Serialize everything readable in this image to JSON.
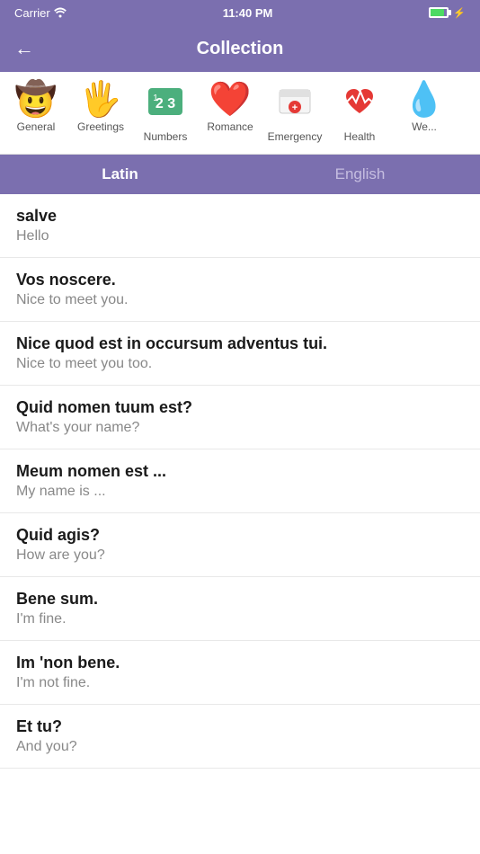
{
  "status": {
    "carrier": "Carrier",
    "time": "11:40 PM"
  },
  "header": {
    "title": "Collection",
    "back_label": "←"
  },
  "categories": [
    {
      "id": "general",
      "emoji": "🤠",
      "label": "General"
    },
    {
      "id": "greetings",
      "emoji": "🖐",
      "label": "Greetings"
    },
    {
      "id": "numbers",
      "emoji": "🔢",
      "label": "Numbers"
    },
    {
      "id": "romance",
      "emoji": "❤️",
      "label": "Romance"
    },
    {
      "id": "emergency",
      "emoji": "🚑",
      "label": "Emergency"
    },
    {
      "id": "health",
      "emoji": "❤️‍🩺",
      "label": "Health"
    },
    {
      "id": "weather",
      "emoji": "💧",
      "label": "We..."
    }
  ],
  "lang_tabs": [
    {
      "id": "latin",
      "label": "Latin",
      "active": true
    },
    {
      "id": "english",
      "label": "English",
      "active": false
    }
  ],
  "phrases": [
    {
      "latin": "salve",
      "english": "Hello"
    },
    {
      "latin": "Vos noscere.",
      "english": "Nice to meet you."
    },
    {
      "latin": "Nice quod est in occursum adventus tui.",
      "english": "Nice to meet you too."
    },
    {
      "latin": "Quid nomen tuum est?",
      "english": "What's your name?"
    },
    {
      "latin": "Meum nomen est ...",
      "english": "My name is ..."
    },
    {
      "latin": "Quid agis?",
      "english": "How are you?"
    },
    {
      "latin": "Bene sum.",
      "english": "I'm fine."
    },
    {
      "latin": "Im 'non bene.",
      "english": "I'm not fine."
    },
    {
      "latin": "Et tu?",
      "english": "And you?"
    }
  ]
}
